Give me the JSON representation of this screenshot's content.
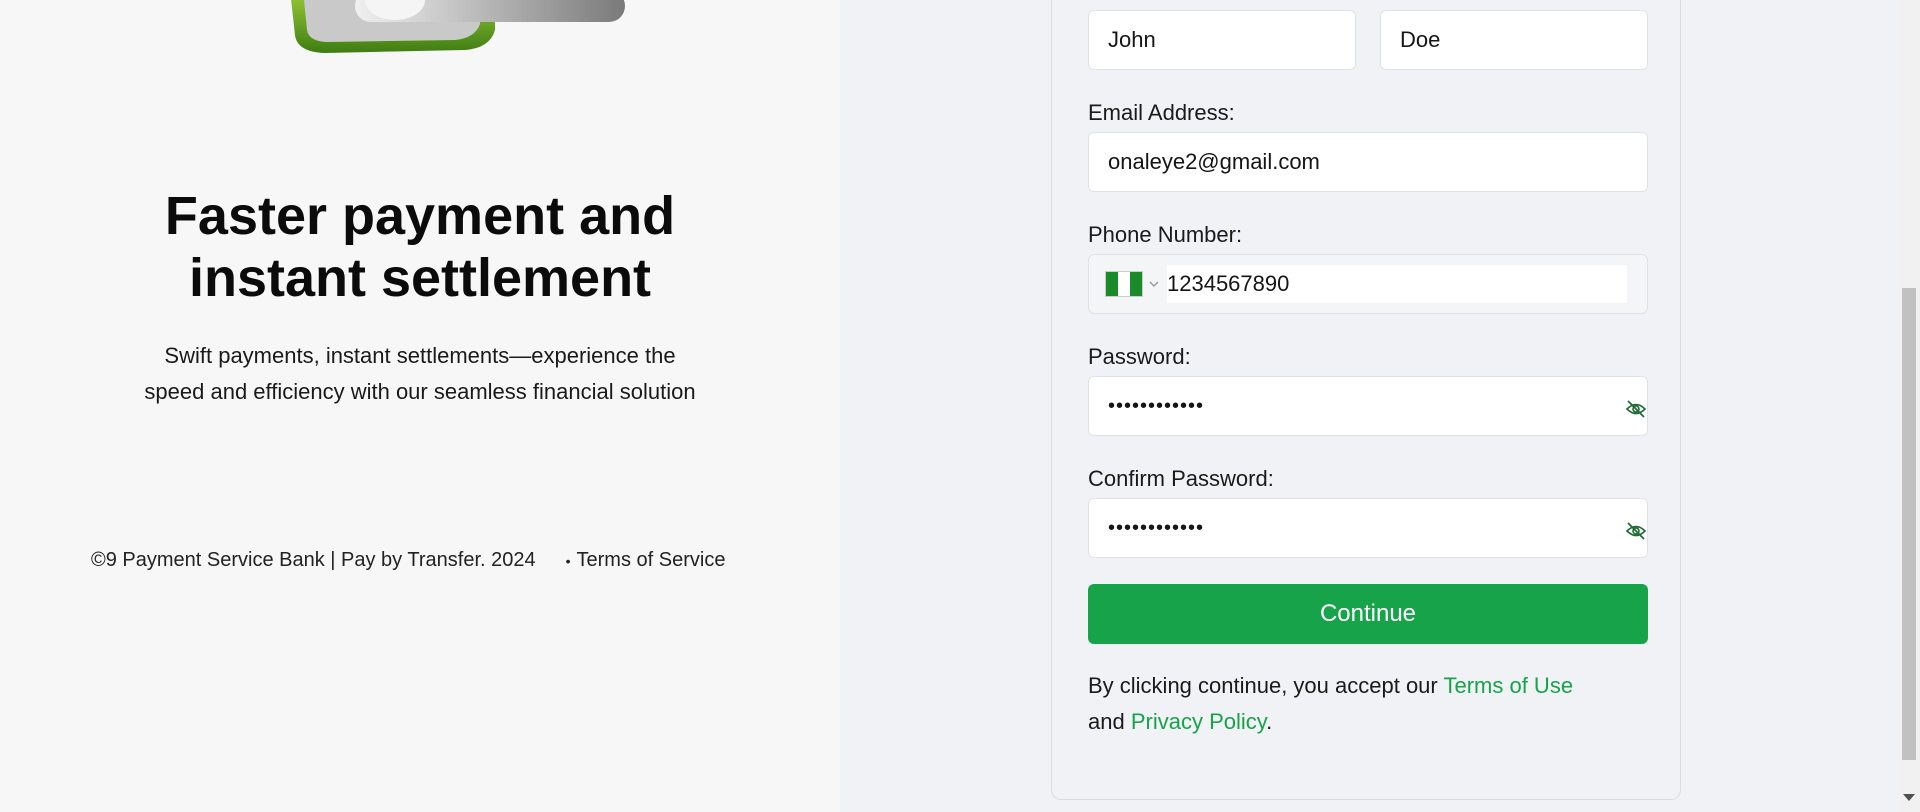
{
  "hero": {
    "title_line1": "Faster payment and",
    "title_line2": "instant settlement",
    "subtitle_line1": "Swift payments, instant settlements—experience the",
    "subtitle_line2": "speed and efficiency with our seamless financial solution"
  },
  "footer": {
    "copyright": "©9 Payment Service Bank | Pay by Transfer. 2024",
    "terms_link": "Terms of Service"
  },
  "form": {
    "first_name": "John",
    "last_name": "Doe",
    "email_label": "Email Address:",
    "email_value": "onaleye2@gmail.com",
    "phone_label": "Phone Number:",
    "phone_value": "1234567890",
    "phone_country_icon": "nigeria-flag-icon",
    "password_label": "Password:",
    "password_value": "••••••••••••",
    "confirm_password_label": "Confirm Password:",
    "confirm_password_value": "••••••••••••",
    "continue_label": "Continue",
    "consent_prefix": "By clicking continue, you accept our ",
    "terms_of_use": "Terms of Use",
    "consent_and": "and ",
    "privacy_policy": "Privacy Policy",
    "consent_suffix": "."
  },
  "colors": {
    "accent": "#17a34a",
    "left_bg": "#f7f7f7",
    "right_bg": "#f1f2f5"
  }
}
